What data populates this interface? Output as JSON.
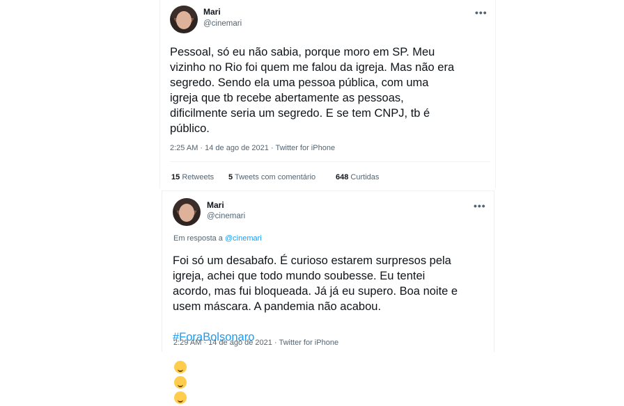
{
  "tweet1": {
    "name": "Mari",
    "handle": "@cinemari",
    "more": "•••",
    "text": "Pessoal, só eu não sabia, porque moro em SP. Meu\nvizinho no Rio foi quem me falou da igreja. Mas não era\nsegredo. Sendo ela uma pessoa pública, com uma\nigreja que tb recebe abertamente as pessoas,\ndificilmente seria um segredo. E se tem CNPJ, tb é\npúblico.",
    "meta": "2:25 AM · 14 de ago de 2021 · Twitter for iPhone",
    "stats": [
      {
        "count": "15",
        "label": "Retweets"
      },
      {
        "count": "5",
        "label": "Tweets com comentário"
      },
      {
        "count": "648",
        "label": "Curtidas"
      }
    ]
  },
  "tweet2": {
    "name": "Mari",
    "handle": "@cinemari",
    "more": "•••",
    "reply_prefix": "Em resposta a",
    "reply_to": "@cinemari",
    "text": "Foi só um desabafo. É curioso estarem surpresos pela\nigreja, achei que todo mundo soubesse. Eu tentei\nacordo, mas fui bloqueada. Já já eu supero. Boa noite e\nusem máscara. A pandemia não acabou.",
    "hashtag": "#ForaBolsonaro",
    "emojis": [
      "smiling-face-with-hearts",
      "face-blowing-kiss",
      "winking-face"
    ],
    "meta": "2:29 AM · 14 de ago de 2021 · Twitter for iPhone"
  }
}
